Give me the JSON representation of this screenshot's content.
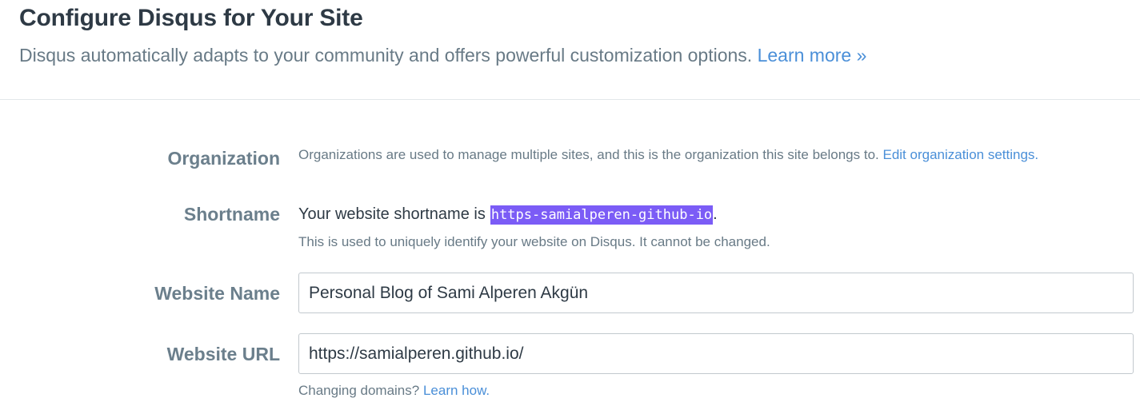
{
  "header": {
    "title": "Configure Disqus for Your Site",
    "subtitle": "Disqus automatically adapts to your community and offers powerful customization options.",
    "learn_more_link": "Learn more »"
  },
  "organization": {
    "label": "Organization",
    "description": "Organizations are used to manage multiple sites, and this is the organization this site belongs to.",
    "edit_link": "Edit organization settings."
  },
  "shortname": {
    "label": "Shortname",
    "prefix": "Your website shortname is",
    "value": "https-samialperen-github-io",
    "suffix": ".",
    "help": "This is used to uniquely identify your website on Disqus. It cannot be changed.",
    "highlight_color": "#7b5cf6"
  },
  "website_name": {
    "label": "Website Name",
    "value": "Personal Blog of Sami Alperen Akgün"
  },
  "website_url": {
    "label": "Website URL",
    "value": "https://samialperen.github.io/",
    "help_prefix": "Changing domains?",
    "help_link": "Learn how."
  },
  "colors": {
    "link": "#4a8fd8",
    "label": "#6b7f8c",
    "title": "#2e3a45",
    "muted": "#687a86"
  }
}
